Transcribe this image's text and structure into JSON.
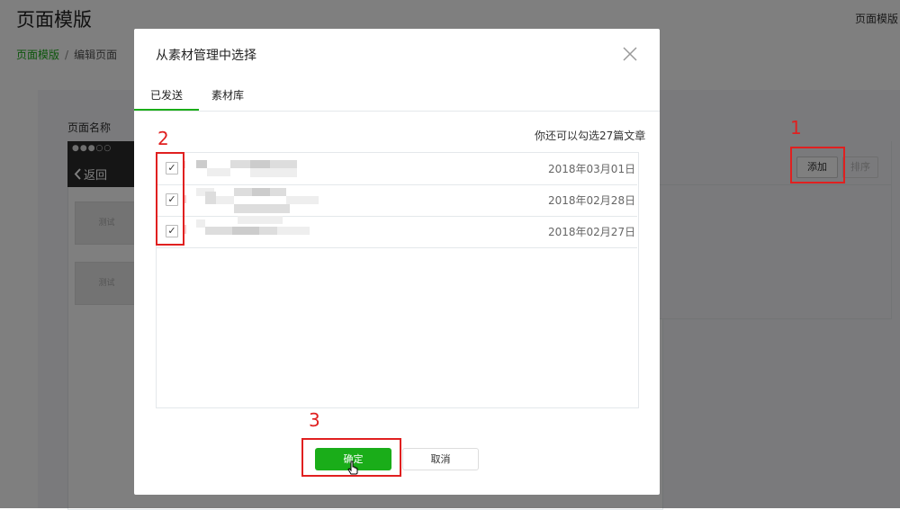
{
  "page": {
    "title": "页面模版",
    "top_right": "页面模版",
    "breadcrumb": {
      "link": "页面模版",
      "separator": "/",
      "current": "编辑页面"
    },
    "name_label": "页面名称",
    "phone": {
      "status": "●●●○○",
      "back": "返回",
      "placeholder": "测试"
    },
    "buttons": {
      "add": "添加",
      "sort": "排序"
    }
  },
  "dialog": {
    "title": "从素材管理中选择",
    "close_icon": "close-icon",
    "tabs": [
      {
        "label": "已发送",
        "active": true
      },
      {
        "label": "素材库",
        "active": false
      }
    ],
    "remaining": "你还可以勾选27篇文章",
    "items": [
      {
        "checked": true,
        "date": "2018年03月01日"
      },
      {
        "checked": true,
        "date": "2018年02月28日"
      },
      {
        "checked": true,
        "date": "2018年02月27日"
      }
    ],
    "confirm_label": "确定",
    "cancel_label": "取消"
  },
  "annotations": {
    "step1": "1",
    "step2": "2",
    "step3": "3"
  },
  "colors": {
    "accent": "#1aad19",
    "annotation": "#e02020"
  }
}
